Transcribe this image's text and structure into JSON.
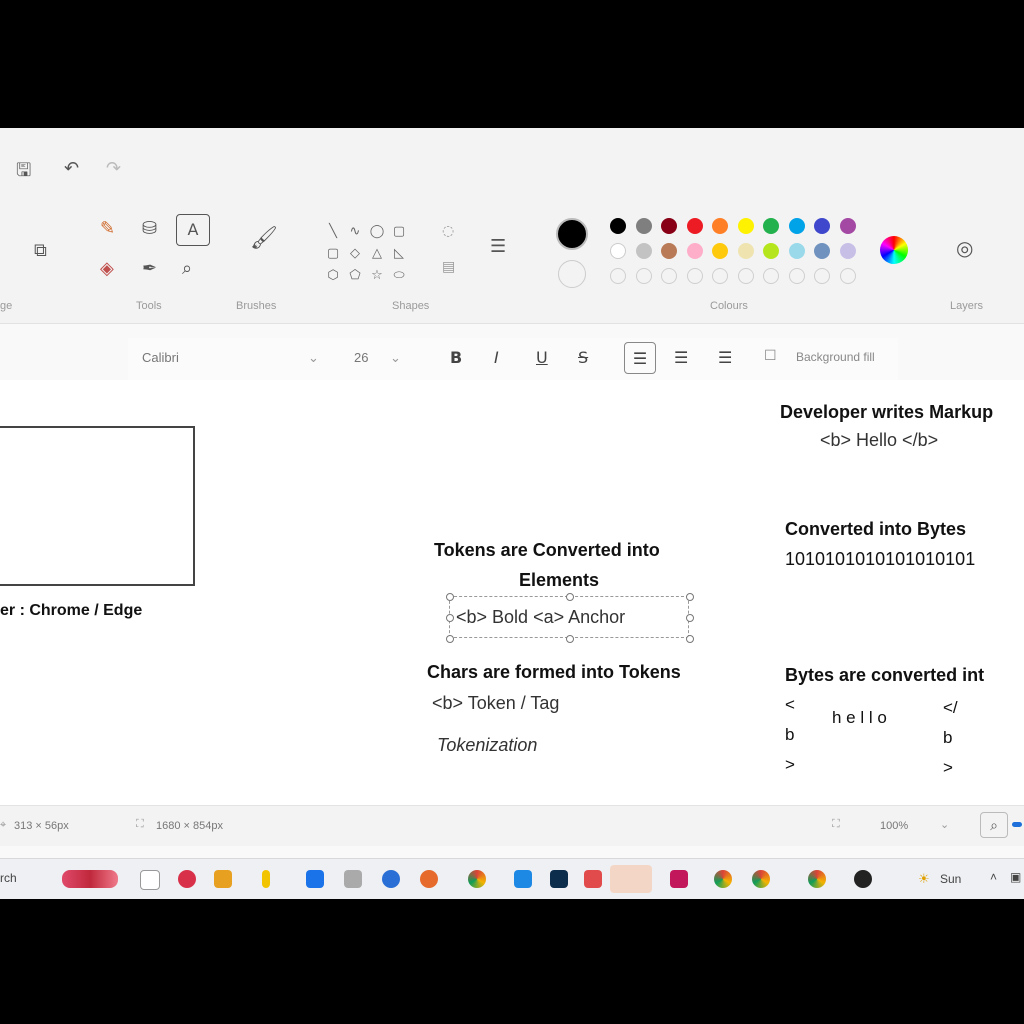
{
  "ribbon": {
    "groups": {
      "image": "ge",
      "tools": "Tools",
      "brushes": "Brushes",
      "shapes": "Shapes",
      "colours": "Colours",
      "layers": "Layers"
    },
    "text_tool_glyph": "A",
    "shape_glyphs": [
      "╲",
      "∿",
      "◯",
      "▢",
      "▢",
      "◇",
      "△",
      "◺",
      "⬡",
      "⬠",
      "☆",
      "⬭"
    ]
  },
  "palette": {
    "row1": [
      "#000000",
      "#7f7f7f",
      "#880015",
      "#ed1c24",
      "#ff7f27",
      "#fff200",
      "#22b14c",
      "#00a2e8",
      "#3f48cc",
      "#a349a4"
    ],
    "row2": [
      "#ffffff",
      "#c3c3c3",
      "#b97a57",
      "#ffaec9",
      "#ffc90e",
      "#efe4b0",
      "#b5e61d",
      "#99d9ea",
      "#7092be",
      "#c8bfe7"
    ],
    "current": "#000000"
  },
  "text_toolbar": {
    "font": "Calibri",
    "size": "26",
    "bold": "B",
    "italic": "I",
    "underline": "U",
    "strike": "S",
    "background_fill": "Background fill"
  },
  "canvas": {
    "browser_caption": "er : Chrome / Edge",
    "dev_title": "Developer writes Markup",
    "dev_code": "<b> Hello </b>",
    "bytes_title": "Converted into Bytes",
    "bytes_value": "1010101010101010101",
    "tokens_title_1": "Tokens are Converted into",
    "tokens_title_2": "Elements",
    "tokens_text": "<b> Bold <a> Anchor",
    "chars_title": "Chars are formed into Tokens",
    "chars_text": "<b>  Token / Tag",
    "tokenization": "Tokenization",
    "bytes_chars_title": "Bytes are converted int",
    "col1": [
      "<",
      "b",
      ">"
    ],
    "hello": "h e l l o",
    "col3": [
      "</",
      "b",
      ">"
    ]
  },
  "status": {
    "cursor": "313 × 56px",
    "canvas_size": "1680 × 854px",
    "zoom": "100%"
  },
  "taskbar": {
    "search": "rch",
    "weather": "Sun"
  }
}
